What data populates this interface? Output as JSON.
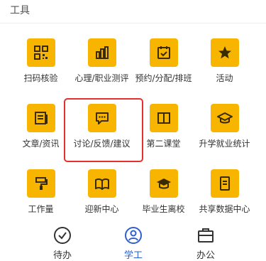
{
  "section": {
    "title": "工具"
  },
  "tiles": [
    {
      "label": "扫码核验",
      "icon": "qr-code-icon"
    },
    {
      "label": "心理/职业测评",
      "icon": "bar-chart-icon"
    },
    {
      "label": "预约/分配/排班",
      "icon": "calendar-check-icon"
    },
    {
      "label": "活动",
      "icon": "star-icon"
    },
    {
      "label": "文章/资讯",
      "icon": "article-icon"
    },
    {
      "label": "讨论/反馈/建议",
      "icon": "chat-bubble-icon",
      "highlighted": true
    },
    {
      "label": "第二课堂",
      "icon": "open-book-icon"
    },
    {
      "label": "升学就业统计",
      "icon": "graduation-cap-icon"
    },
    {
      "label": "工作量",
      "icon": "paint-roller-icon"
    },
    {
      "label": "迎新中心",
      "icon": "book-reader-icon"
    },
    {
      "label": "毕业生离校",
      "icon": "graduation-hat-icon"
    },
    {
      "label": "共享数据中心",
      "icon": "document-list-icon"
    }
  ],
  "tabbar": {
    "items": [
      {
        "label": "待办",
        "icon": "check-circle-icon",
        "active": false
      },
      {
        "label": "学工",
        "icon": "user-circle-icon",
        "active": true
      },
      {
        "label": "办公",
        "icon": "briefcase-icon",
        "active": false
      }
    ]
  },
  "colors": {
    "tile_bg": "#f7b500",
    "highlight": "#e3322c",
    "active_tab": "#2f5fcf"
  }
}
